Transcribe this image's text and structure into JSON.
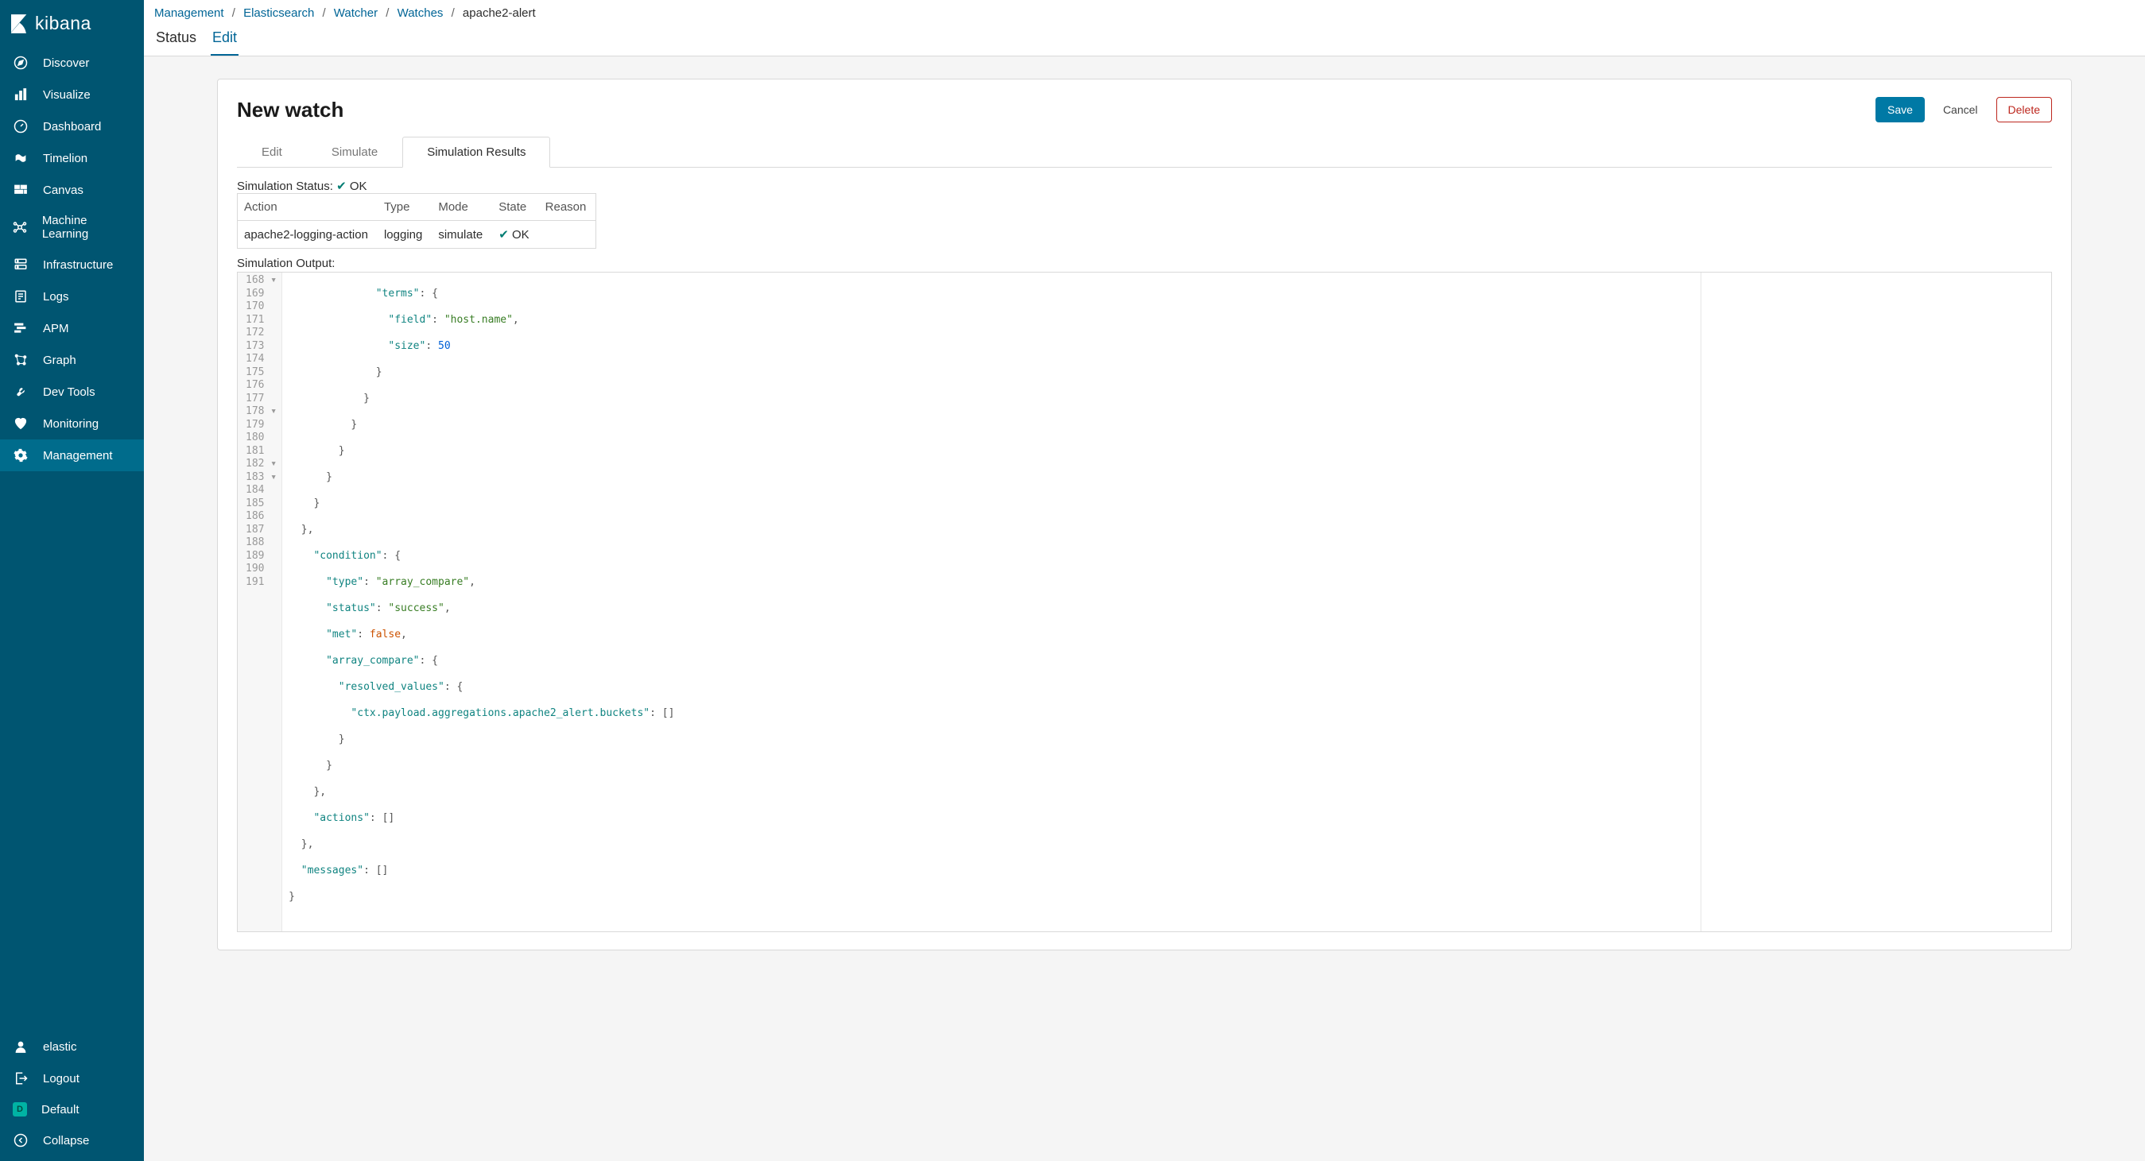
{
  "brand": "kibana",
  "sidebar": {
    "items": [
      {
        "label": "Discover"
      },
      {
        "label": "Visualize"
      },
      {
        "label": "Dashboard"
      },
      {
        "label": "Timelion"
      },
      {
        "label": "Canvas"
      },
      {
        "label": "Machine Learning"
      },
      {
        "label": "Infrastructure"
      },
      {
        "label": "Logs"
      },
      {
        "label": "APM"
      },
      {
        "label": "Graph"
      },
      {
        "label": "Dev Tools"
      },
      {
        "label": "Monitoring"
      },
      {
        "label": "Management"
      }
    ],
    "footer": {
      "user": "elastic",
      "logout": "Logout",
      "default_label": "Default",
      "default_badge": "D",
      "collapse": "Collapse"
    }
  },
  "breadcrumbs": {
    "items": [
      "Management",
      "Elasticsearch",
      "Watcher",
      "Watches"
    ],
    "current": "apache2-alert",
    "sep": "/"
  },
  "toptabs": {
    "status": "Status",
    "edit": "Edit"
  },
  "panel": {
    "title": "New watch",
    "actions": {
      "save": "Save",
      "cancel": "Cancel",
      "delete": "Delete"
    }
  },
  "subtabs": {
    "edit": "Edit",
    "simulate": "Simulate",
    "results": "Simulation Results"
  },
  "simulation": {
    "status_label": "Simulation Status:",
    "status_value": "OK",
    "table": {
      "headers": {
        "action": "Action",
        "type": "Type",
        "mode": "Mode",
        "state": "State",
        "reason": "Reason"
      },
      "row": {
        "action": "apache2-logging-action",
        "type": "logging",
        "mode": "simulate",
        "state": "OK",
        "reason": ""
      }
    },
    "output_label": "Simulation Output:"
  },
  "editor": {
    "lines": [
      {
        "n": "168",
        "fold": true
      },
      {
        "n": "169"
      },
      {
        "n": "170"
      },
      {
        "n": "171"
      },
      {
        "n": "172"
      },
      {
        "n": "173"
      },
      {
        "n": "174"
      },
      {
        "n": "175"
      },
      {
        "n": "176"
      },
      {
        "n": "177"
      },
      {
        "n": "178",
        "fold": true
      },
      {
        "n": "179"
      },
      {
        "n": "180"
      },
      {
        "n": "181"
      },
      {
        "n": "182",
        "fold": true
      },
      {
        "n": "183",
        "fold": true
      },
      {
        "n": "184"
      },
      {
        "n": "185"
      },
      {
        "n": "186"
      },
      {
        "n": "187"
      },
      {
        "n": "188"
      },
      {
        "n": "189"
      },
      {
        "n": "190"
      },
      {
        "n": "191"
      }
    ],
    "json_content": {
      "line168": {
        "key": "\"terms\"",
        "open": ": {"
      },
      "line169": {
        "key": "\"field\"",
        "val": "\"host.name\"",
        "comma": ","
      },
      "line170": {
        "key": "\"size\"",
        "val": "50"
      },
      "line178": {
        "key": "\"condition\"",
        "open": ": {"
      },
      "line179": {
        "key": "\"type\"",
        "val": "\"array_compare\"",
        "comma": ","
      },
      "line180": {
        "key": "\"status\"",
        "val": "\"success\"",
        "comma": ","
      },
      "line181": {
        "key": "\"met\"",
        "val": "false",
        "comma": ","
      },
      "line182": {
        "key": "\"array_compare\"",
        "open": ": {"
      },
      "line183": {
        "key": "\"resolved_values\"",
        "open": ": {"
      },
      "line184": {
        "key": "\"ctx.payload.aggregations.apache2_alert.buckets\"",
        "val": "[]"
      },
      "line188": {
        "key": "\"actions\"",
        "val": "[]"
      },
      "line190": {
        "key": "\"messages\"",
        "val": "[]"
      },
      "close": "}",
      "close_comma": "},"
    }
  }
}
